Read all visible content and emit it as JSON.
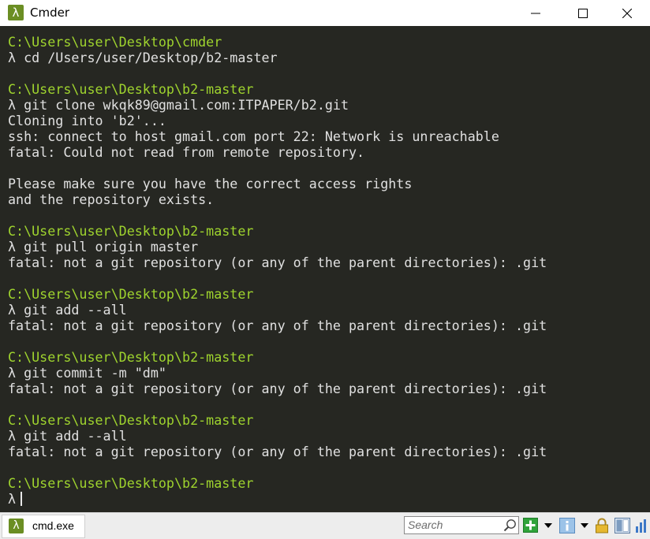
{
  "window": {
    "title": "Cmder",
    "icon_glyph": "λ",
    "controls": {
      "minimize_icon": "minimize-icon",
      "maximize_icon": "maximize-icon",
      "close_icon": "close-icon"
    }
  },
  "console": {
    "lines": [
      {
        "kind": "path",
        "text": "C:\\Users\\user\\Desktop\\cmder"
      },
      {
        "kind": "cmd",
        "text": "λ cd /Users/user/Desktop/b2-master"
      },
      {
        "kind": "blank",
        "text": ""
      },
      {
        "kind": "path",
        "text": "C:\\Users\\user\\Desktop\\b2-master"
      },
      {
        "kind": "cmd",
        "text": "λ git clone wkqk89@gmail.com:ITPAPER/b2.git"
      },
      {
        "kind": "out",
        "text": "Cloning into 'b2'..."
      },
      {
        "kind": "out",
        "text": "ssh: connect to host gmail.com port 22: Network is unreachable"
      },
      {
        "kind": "out",
        "text": "fatal: Could not read from remote repository."
      },
      {
        "kind": "blank",
        "text": ""
      },
      {
        "kind": "out",
        "text": "Please make sure you have the correct access rights"
      },
      {
        "kind": "out",
        "text": "and the repository exists."
      },
      {
        "kind": "blank",
        "text": ""
      },
      {
        "kind": "path",
        "text": "C:\\Users\\user\\Desktop\\b2-master"
      },
      {
        "kind": "cmd",
        "text": "λ git pull origin master"
      },
      {
        "kind": "out",
        "text": "fatal: not a git repository (or any of the parent directories): .git"
      },
      {
        "kind": "blank",
        "text": ""
      },
      {
        "kind": "path",
        "text": "C:\\Users\\user\\Desktop\\b2-master"
      },
      {
        "kind": "cmd",
        "text": "λ git add --all"
      },
      {
        "kind": "out",
        "text": "fatal: not a git repository (or any of the parent directories): .git"
      },
      {
        "kind": "blank",
        "text": ""
      },
      {
        "kind": "path",
        "text": "C:\\Users\\user\\Desktop\\b2-master"
      },
      {
        "kind": "cmd",
        "text": "λ git commit -m \"dm\""
      },
      {
        "kind": "out",
        "text": "fatal: not a git repository (or any of the parent directories): .git"
      },
      {
        "kind": "blank",
        "text": ""
      },
      {
        "kind": "path",
        "text": "C:\\Users\\user\\Desktop\\b2-master"
      },
      {
        "kind": "cmd",
        "text": "λ git add --all"
      },
      {
        "kind": "out",
        "text": "fatal: not a git repository (or any of the parent directories): .git"
      },
      {
        "kind": "blank",
        "text": ""
      },
      {
        "kind": "path",
        "text": "C:\\Users\\user\\Desktop\\b2-master"
      }
    ],
    "prompt": "λ"
  },
  "statusbar": {
    "tab_label": "cmd.exe",
    "tab_icon_glyph": "λ",
    "search_placeholder": "Search",
    "buttons": [
      "new-console-icon",
      "dropdown-icon",
      "info-icon",
      "dropdown-icon",
      "lock-icon",
      "split-view-icon",
      "chart-icon"
    ]
  },
  "colors": {
    "console_bg": "#262722",
    "path_text": "#9fd42e",
    "output_text": "#e0e0e0",
    "accent_green": "#6b8e23"
  }
}
